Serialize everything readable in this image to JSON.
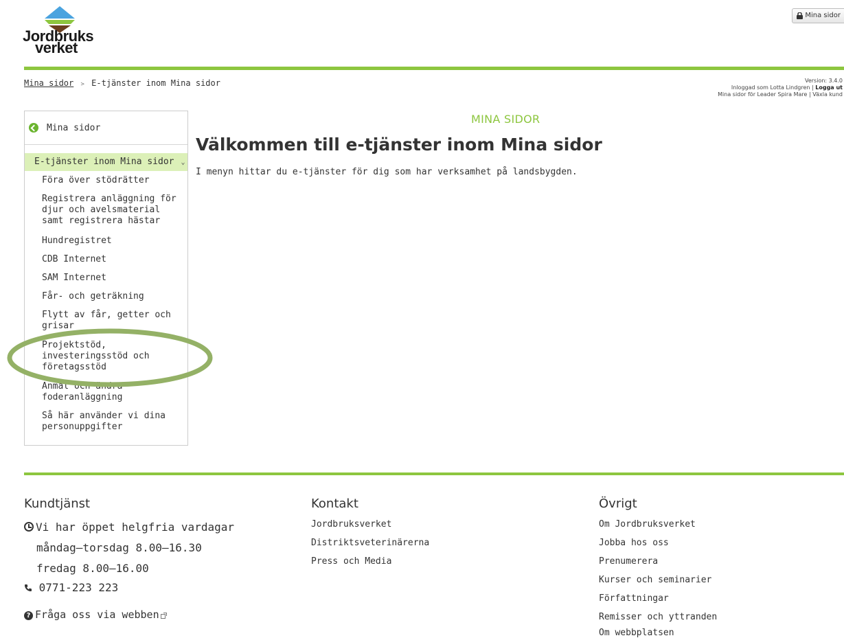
{
  "header": {
    "logo_line1": "Jordbruks",
    "logo_line2": "verket",
    "mina_sidor_button": "Mina sidor"
  },
  "breadcrumb": {
    "home": "Mina sidor",
    "separator": ">",
    "current": "E-tjänster inom Mina sidor"
  },
  "userinfo": {
    "version": "Version: 3.4.0",
    "logged_in_prefix": "Inloggad som Lotta Lindgren |",
    "logout": "Logga ut",
    "org_line": "Mina sidor för Leader Spira Mare | Växla kund"
  },
  "sidebar": {
    "home_label": "Mina sidor",
    "section_label": "E-tjänster inom Mina sidor",
    "items": [
      "Föra över stödrätter",
      "Registrera anläggning för djur och avelsmaterial samt registrera hästar",
      "Hundregistret",
      "CDB Internet",
      "SAM Internet",
      "Får- och geträkning",
      "Flytt av får, getter och grisar",
      "Projektstöd, investeringsstöd och företagsstöd",
      "Anmäl och ändra foderanläggning",
      "Så här använder vi dina personuppgifter"
    ]
  },
  "main": {
    "eyebrow": "MINA SIDOR",
    "heading": "Välkommen till e-tjänster inom Mina sidor",
    "intro": "I menyn hittar du e-tjänster för dig som har verksamhet på landsbygden."
  },
  "footer": {
    "kundtjanst": {
      "title": "Kundtjänst",
      "open": "Vi har öppet helgfria vardagar",
      "hours1": "måndag–torsdag 8.00–16.30",
      "hours2": "fredag 8.00–16.00",
      "phone": "0771-223 223",
      "web": "Fråga oss via webben"
    },
    "kontakt": {
      "title": "Kontakt",
      "links": [
        "Jordbruksverket",
        "Distriktsveterinärerna",
        "Press och Media"
      ]
    },
    "ovrigt": {
      "title": "Övrigt",
      "links": [
        "Om Jordbruksverket",
        "Jobba hos oss",
        "Prenumerera",
        "Kurser och seminarier",
        "Författningar",
        "Remisser och yttranden",
        "Om webbplatsen"
      ]
    }
  },
  "colors": {
    "brand_green": "#8dc63f",
    "active_bg": "#dcf0b8",
    "highlight_ellipse": "#94b166"
  }
}
